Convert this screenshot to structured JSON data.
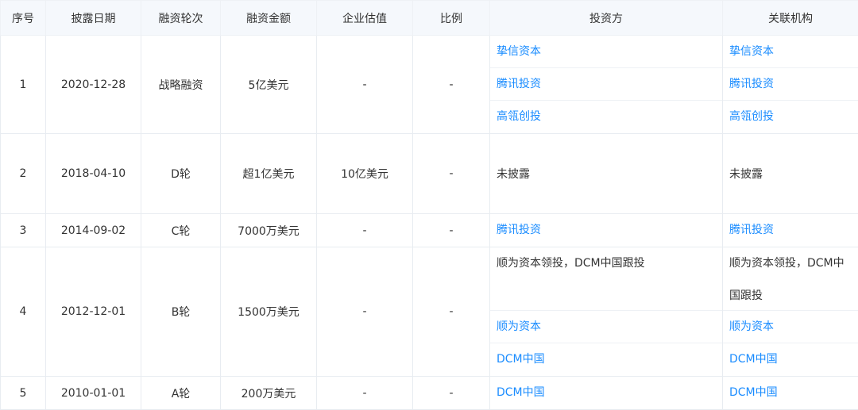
{
  "headers": [
    "序号",
    "披露日期",
    "融资轮次",
    "融资金额",
    "企业估值",
    "比例",
    "投资方",
    "关联机构"
  ],
  "rows": [
    {
      "index": "1",
      "date": "2020-12-28",
      "round": "战略融资",
      "amount": "5亿美元",
      "valuation": "-",
      "ratio": "-",
      "investors": [
        "挚信资本",
        "腾讯投资",
        "高瓴创投"
      ],
      "related": [
        "挚信资本",
        "腾讯投资",
        "高瓴创投"
      ]
    },
    {
      "index": "2",
      "date": "2018-04-10",
      "round": "D轮",
      "amount": "超1亿美元",
      "valuation": "10亿美元",
      "ratio": "-",
      "investors_text": "未披露",
      "related_text": "未披露"
    },
    {
      "index": "3",
      "date": "2014-09-02",
      "round": "C轮",
      "amount": "7000万美元",
      "valuation": "-",
      "ratio": "-",
      "investors": [
        "腾讯投资"
      ],
      "related": [
        "腾讯投资"
      ]
    },
    {
      "index": "4",
      "date": "2012-12-01",
      "round": "B轮",
      "amount": "1500万美元",
      "valuation": "-",
      "ratio": "-",
      "investors_note": "顺为资本领投，DCM中国跟投",
      "related_note": "顺为资本领投，DCM中国跟投",
      "investors": [
        "顺为资本",
        "DCM中国"
      ],
      "related": [
        "顺为资本",
        "DCM中国"
      ]
    },
    {
      "index": "5",
      "date": "2010-01-01",
      "round": "A轮",
      "amount": "200万美元",
      "valuation": "-",
      "ratio": "-",
      "investors": [
        "DCM中国"
      ],
      "related": [
        "DCM中国"
      ]
    }
  ],
  "colors": {
    "link": "#1a8cff",
    "header_bg": "#f5f8fc",
    "border": "#e8ecf1"
  }
}
